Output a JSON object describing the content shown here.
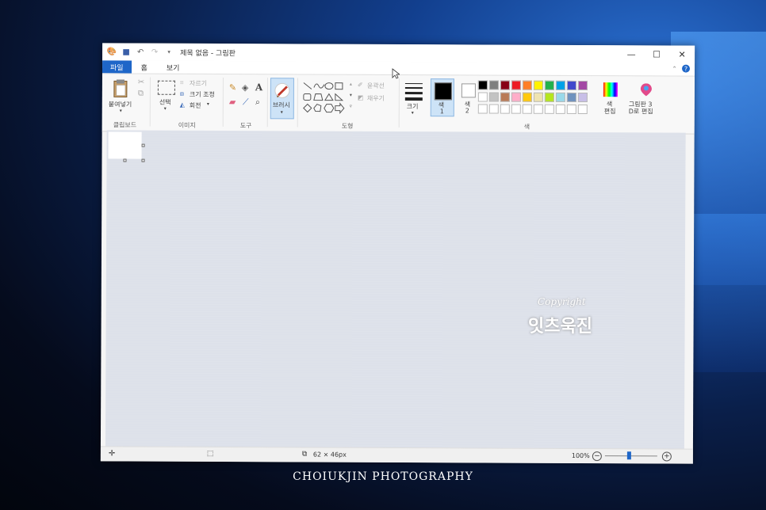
{
  "window": {
    "title": "제목 없음 - 그림판",
    "controls": {
      "minimize": "—",
      "maximize": "☐",
      "close": "✕"
    }
  },
  "tabs": [
    {
      "label": "파일"
    },
    {
      "label": "홈"
    },
    {
      "label": "보기"
    }
  ],
  "ribbon": {
    "clipboard": {
      "paste_label": "붙여넣기",
      "group_label": "클립보드"
    },
    "image": {
      "select_label": "선택",
      "crop_label": "자르기",
      "resize_label": "크기 조정",
      "rotate_label": "회전",
      "group_label": "이미지"
    },
    "tools": {
      "text_glyph": "A",
      "group_label": "도구"
    },
    "brushes": {
      "label": "브러시"
    },
    "shapes": {
      "outline_label": "윤곽선",
      "fill_label": "채우기",
      "group_label": "도형"
    },
    "size": {
      "label": "크기"
    },
    "color1": {
      "label": "색",
      "number": "1",
      "color": "#000000"
    },
    "color2": {
      "label": "색",
      "number": "2",
      "color": "#ffffff"
    },
    "colors": {
      "group_label": "색",
      "row1": [
        "#000000",
        "#7f7f7f",
        "#880015",
        "#ed1c24",
        "#ff7f27",
        "#fff200",
        "#22b14c",
        "#00a2e8",
        "#3f48cc",
        "#a349a4"
      ],
      "row2": [
        "#ffffff",
        "#c3c3c3",
        "#b97a57",
        "#ffaec9",
        "#ffc90e",
        "#efe4b0",
        "#b5e61d",
        "#99d9ea",
        "#7092be",
        "#c8bfe7"
      ],
      "row3": [
        "#ffffff",
        "#ffffff",
        "#ffffff",
        "#ffffff",
        "#ffffff",
        "#ffffff",
        "#ffffff",
        "#ffffff",
        "#ffffff",
        "#ffffff"
      ]
    },
    "edit_colors": {
      "label_line1": "색",
      "label_line2": "편집"
    },
    "paint3d": {
      "label_line1": "그림판 3",
      "label_line2": "D로 편집"
    }
  },
  "statusbar": {
    "selection_size": "62 × 46px",
    "zoom": "100%"
  },
  "watermark": {
    "line1": "Copyright",
    "line2": "잇츠욱진"
  },
  "credit": "CHOIUKJIN PHOTOGRAPHY"
}
